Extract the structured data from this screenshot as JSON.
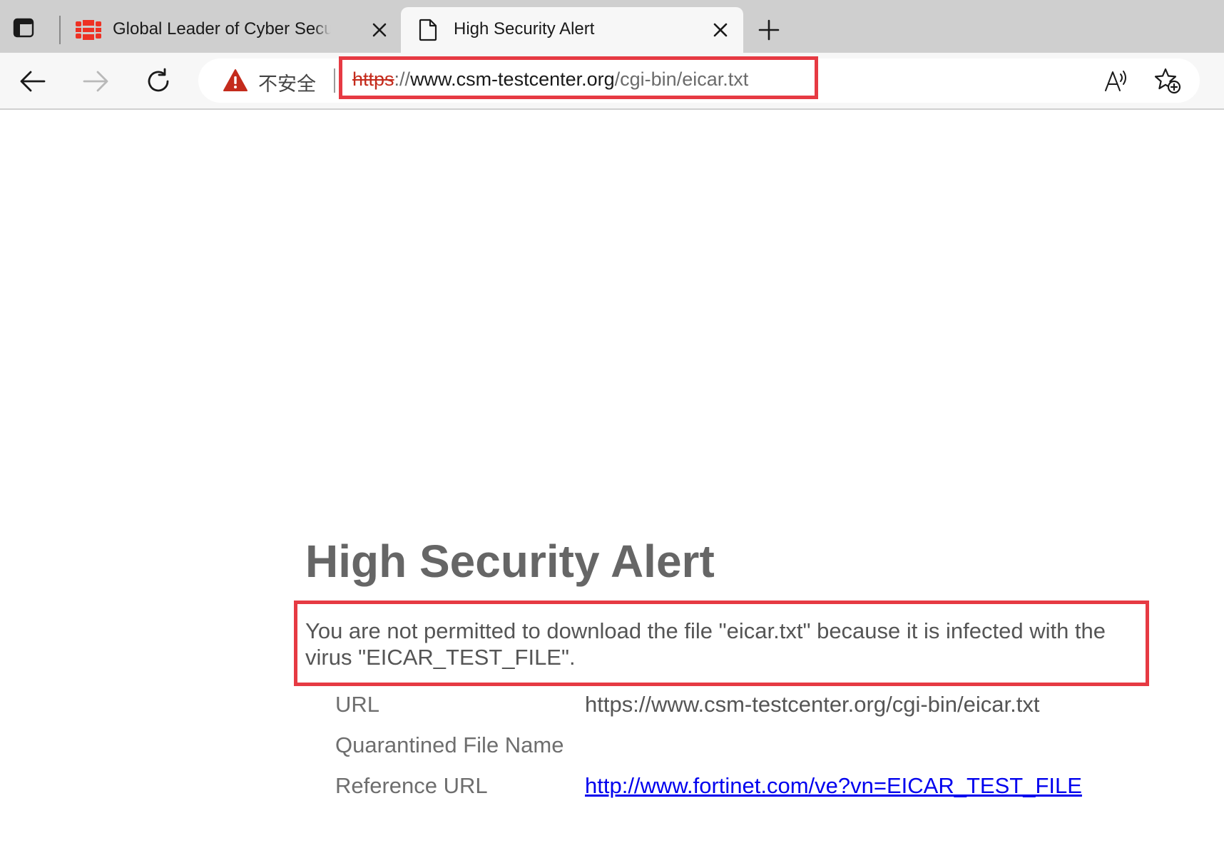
{
  "tabs": [
    {
      "title": "Global Leader of Cyber Security S",
      "favicon": "fortinet-logo",
      "active": false
    },
    {
      "title": "High Security Alert",
      "favicon": "page-icon",
      "active": true
    }
  ],
  "toolbar": {
    "security_label": "不安全",
    "url": {
      "scheme": "https",
      "separator": "://",
      "host": "www.csm-testcenter.org",
      "path": "/cgi-bin/eicar.txt"
    }
  },
  "page": {
    "title": "High Security Alert",
    "message": "You are not permitted to download the file \"eicar.txt\" because it is infected with the virus \"EICAR_TEST_FILE\".",
    "details": [
      {
        "label": "URL",
        "value": "https://www.csm-testcenter.org/cgi-bin/eicar.txt"
      },
      {
        "label": "Quarantined File Name",
        "value": ""
      },
      {
        "label": "Reference URL",
        "value": "http://www.fortinet.com/ve?vn=EICAR_TEST_FILE"
      }
    ]
  },
  "colors": {
    "highlight_box": "#e63a43",
    "warning": "#c42b1c",
    "link": "#0000ee",
    "heading": "#666666",
    "fortinet_red": "#ee3124"
  }
}
